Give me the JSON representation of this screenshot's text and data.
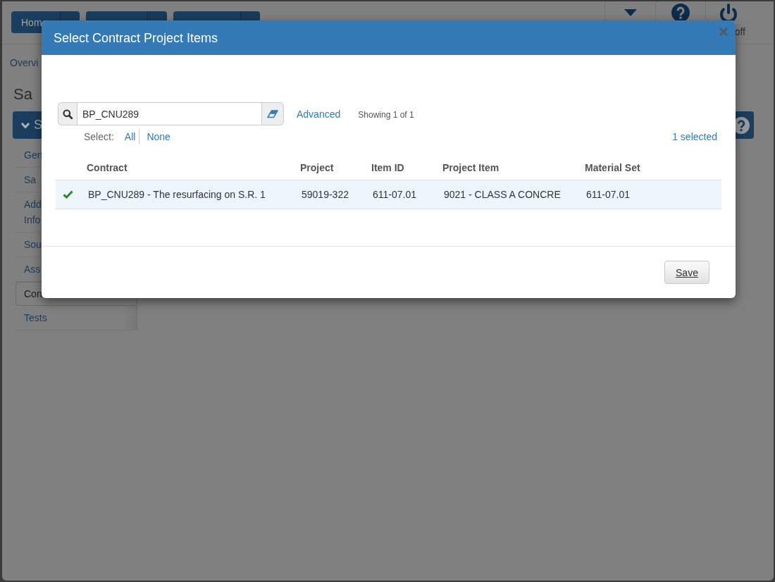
{
  "top_bar": {
    "nav_buttons": [
      {
        "kind": "split",
        "label": "Hom"
      },
      {
        "kind": "split"
      },
      {
        "kind": "split"
      }
    ],
    "tools": [
      {
        "kind": "caret"
      },
      {
        "kind": "help"
      },
      {
        "kind": "power",
        "label": "off"
      }
    ]
  },
  "breadcrumb": "Overvi",
  "heading": "Sa",
  "section_button": {
    "label": "S"
  },
  "sidebar": {
    "items": [
      {
        "label": "Gen",
        "selected": false
      },
      {
        "label": "Sa",
        "selected": false
      },
      {
        "label": "Add\nInfo",
        "selected": false
      },
      {
        "label": "Sou",
        "selected": false
      },
      {
        "label": "Ass",
        "selected": false
      },
      {
        "label": "Con",
        "selected": true
      },
      {
        "label": "Tests",
        "selected": false
      }
    ]
  },
  "dialog": {
    "title": "Select Contract Project Items",
    "search": {
      "value": "BP_CNU289"
    },
    "advanced": "Advanced",
    "showing": "Showing 1 of 1",
    "select": {
      "label": "Select:",
      "all": "All",
      "none": "None"
    },
    "selected_count": "1 selected",
    "table": {
      "columns": [
        "Contract",
        "Project",
        "Item ID",
        "Project Item",
        "Material Set"
      ],
      "rows": [
        {
          "selected": true,
          "cells": [
            "BP_CNU289 - The resurfacing on S.R. 1",
            "59019-322",
            "611-07.01",
            "9021 - CLASS A CONCRE",
            "611-07.01"
          ]
        }
      ]
    },
    "buttons": [
      {
        "label": "Save"
      }
    ]
  }
}
